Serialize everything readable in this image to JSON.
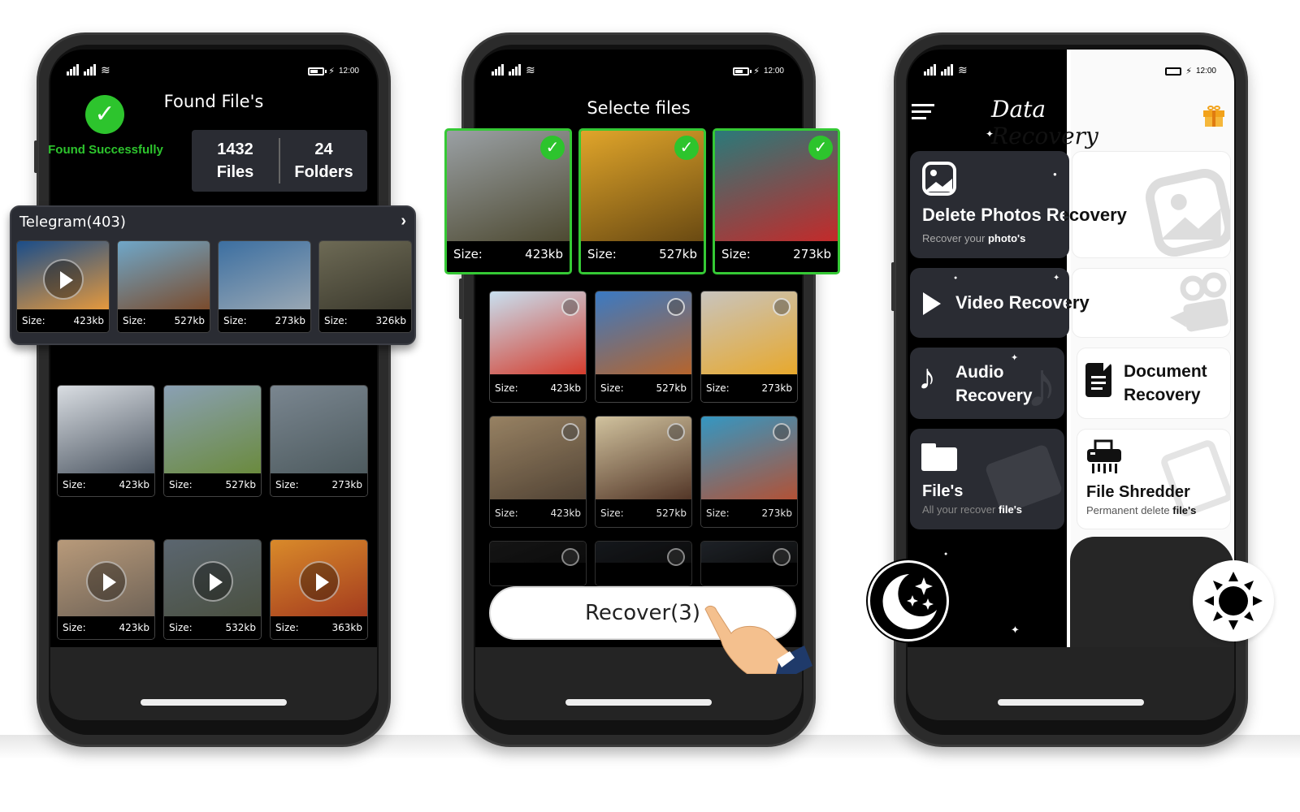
{
  "status_bar": {
    "time": "12:00"
  },
  "phone1": {
    "title": "Found File's",
    "found_text": "Found Successfully",
    "stats": [
      {
        "value": "1432",
        "label": "Files"
      },
      {
        "value": "24",
        "label": "Folders"
      }
    ],
    "telegram": {
      "title": "Telegram(403)",
      "items": [
        {
          "size_label": "Size:",
          "size": "423kb",
          "video": true,
          "colors": [
            "#1a4d8a",
            "#e89a3c"
          ]
        },
        {
          "size_label": "Size:",
          "size": "527kb",
          "video": false,
          "colors": [
            "#6fa7c9",
            "#7a4a2a"
          ]
        },
        {
          "size_label": "Size:",
          "size": "273kb",
          "video": false,
          "colors": [
            "#3c6fa1",
            "#9aa8b4"
          ]
        },
        {
          "size_label": "Size:",
          "size": "326kb",
          "video": false,
          "colors": [
            "#6d6a55",
            "#3a382c"
          ]
        }
      ]
    },
    "grid": [
      {
        "size_label": "Size:",
        "size": "423kb",
        "video": false,
        "colors": [
          "#d9dde2",
          "#4b5561"
        ]
      },
      {
        "size_label": "Size:",
        "size": "527kb",
        "video": false,
        "colors": [
          "#8aa0b4",
          "#6a8a3c"
        ]
      },
      {
        "size_label": "Size:",
        "size": "273kb",
        "video": false,
        "colors": [
          "#7a8690",
          "#4d5a5e"
        ]
      },
      {
        "size_label": "Size:",
        "size": "423kb",
        "video": true,
        "colors": [
          "#b89a7a",
          "#6e6256"
        ]
      },
      {
        "size_label": "Size:",
        "size": "532kb",
        "video": true,
        "colors": [
          "#5b6670",
          "#4a5040"
        ]
      },
      {
        "size_label": "Size:",
        "size": "363kb",
        "video": true,
        "colors": [
          "#d98a2a",
          "#a33a1e"
        ]
      }
    ]
  },
  "phone2": {
    "title": "Selecte files",
    "selected": [
      {
        "size_label": "Size:",
        "size": "423kb",
        "colors": [
          "#9aa0a4",
          "#4e4a32"
        ]
      },
      {
        "size_label": "Size:",
        "size": "527kb",
        "colors": [
          "#e0a52a",
          "#6a4a12"
        ]
      },
      {
        "size_label": "Size:",
        "size": "273kb",
        "colors": [
          "#2a7a7a",
          "#c42a2a"
        ]
      }
    ],
    "grid": [
      {
        "size_label": "Size:",
        "size": "423kb",
        "colors": [
          "#c8e0f0",
          "#d43a2a"
        ]
      },
      {
        "size_label": "Size:",
        "size": "527kb",
        "colors": [
          "#3a7ac4",
          "#b8642a"
        ]
      },
      {
        "size_label": "Size:",
        "size": "273kb",
        "colors": [
          "#c8c4be",
          "#e8a82a"
        ]
      },
      {
        "size_label": "Size:",
        "size": "423kb",
        "colors": [
          "#a8906e",
          "#5a4a3a"
        ]
      },
      {
        "size_label": "Size:",
        "size": "527kb",
        "colors": [
          "#e8d8b0",
          "#5a3a2a"
        ]
      },
      {
        "size_label": "Size:",
        "size": "273kb",
        "colors": [
          "#3aa8d8",
          "#c85a3a"
        ]
      },
      {
        "size_label": "",
        "size": "",
        "colors": [
          "#1e1e1e",
          "#111111"
        ]
      },
      {
        "size_label": "",
        "size": "",
        "colors": [
          "#1e2228",
          "#111111"
        ]
      },
      {
        "size_label": "",
        "size": "",
        "colors": [
          "#2a3038",
          "#141414"
        ]
      }
    ],
    "recover_button": "Recover(3)"
  },
  "phone3": {
    "app_title": "Data Recovery",
    "cards": [
      {
        "title": "Delete Photos Recovery",
        "sub_prefix": "Recover your",
        "sub_bold": "photo's"
      },
      {
        "title": "Video Recovery"
      },
      {
        "title_line1": "Audio",
        "title_line2": "Recovery"
      },
      {
        "title_line1": "Document",
        "title_line2": "Recovery"
      },
      {
        "title": "File's",
        "sub_prefix": "All your recover",
        "sub_bold": "file's"
      },
      {
        "title": "File Shredder",
        "sub_prefix": "Permanent delete",
        "sub_bold": "file's"
      }
    ],
    "icons": {
      "menu": "hamburger-menu-icon",
      "gift": "gift-icon",
      "night": "moon-icon",
      "day": "sun-icon"
    }
  },
  "colors": {
    "accent_green": "#2dc42d",
    "panel_dark": "#2a2c33",
    "gift_orange": "#f2a21a"
  }
}
